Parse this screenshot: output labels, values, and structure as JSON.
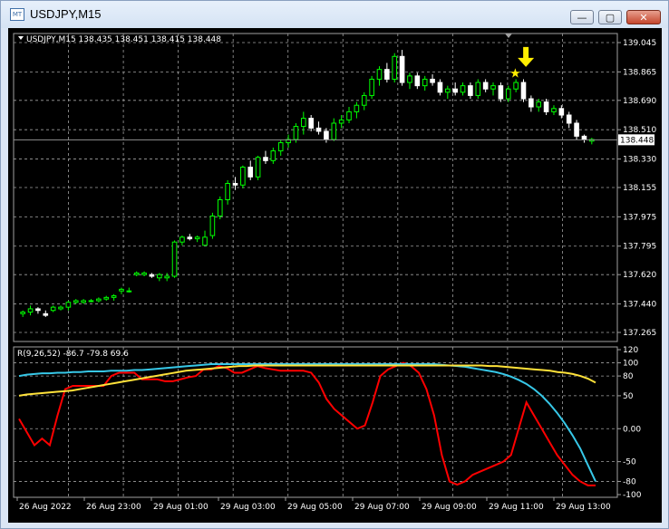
{
  "window": {
    "title": "USDJPY,M15",
    "app_icon_label": "MT",
    "buttons": {
      "minimize": "—",
      "maximize": "▢",
      "close": "✕"
    }
  },
  "colors": {
    "background": "#000000",
    "grid": "#a0a0a0",
    "bull_candle": "#00ff00",
    "bear_candle": "#ffffff",
    "red_line": "#ff0000",
    "cyan_line": "#37c8e8",
    "yellow_line": "#ffe23a",
    "arrow": "#ffee00",
    "text": "#ffffff"
  },
  "chart_header": {
    "symbol_line": "USDJPY,M15  138.435 138.451 138.415 138.448"
  },
  "current_price_label": "138.448",
  "indicator_label": "R(9,26,52) -86.7 -79.8 69.6",
  "price_axis_labels": [
    "139.045",
    "138.865",
    "138.690",
    "138.510",
    "138.330",
    "138.155",
    "137.975",
    "137.795",
    "137.620",
    "137.440",
    "137.265"
  ],
  "indicator_axis_labels": [
    "120",
    "100",
    "80",
    "50",
    "0.00",
    "-50",
    "-80",
    "-100"
  ],
  "time_labels": [
    "26 Aug 2022",
    "26 Aug 23:00",
    "29 Aug 01:00",
    "29 Aug 03:00",
    "29 Aug 05:00",
    "29 Aug 07:00",
    "29 Aug 09:00",
    "29 Aug 11:00",
    "29 Aug 13:00"
  ],
  "chart_data": {
    "type": "line",
    "price_range": [
      137.265,
      139.045
    ],
    "indicator_range": [
      -100,
      120
    ],
    "candles": [
      [
        137.38,
        137.4,
        137.36,
        137.39
      ],
      [
        137.39,
        137.43,
        137.37,
        137.41
      ],
      [
        137.41,
        137.42,
        137.38,
        137.4
      ],
      [
        137.38,
        137.4,
        137.36,
        137.37
      ],
      [
        137.4,
        137.43,
        137.39,
        137.42
      ],
      [
        137.41,
        137.43,
        137.4,
        137.42
      ],
      [
        137.42,
        137.46,
        137.4,
        137.45
      ],
      [
        137.45,
        137.47,
        137.44,
        137.46
      ],
      [
        137.45,
        137.47,
        137.44,
        137.46
      ],
      [
        137.46,
        137.47,
        137.45,
        137.46
      ],
      [
        137.46,
        137.48,
        137.45,
        137.47
      ],
      [
        137.47,
        137.49,
        137.46,
        137.48
      ],
      [
        137.48,
        137.5,
        137.46,
        137.49
      ],
      [
        137.52,
        137.54,
        137.5,
        137.53
      ],
      [
        137.52,
        137.54,
        137.51,
        137.52
      ],
      [
        137.62,
        137.64,
        137.61,
        137.63
      ],
      [
        137.62,
        137.64,
        137.61,
        137.63
      ],
      [
        137.62,
        137.63,
        137.6,
        137.61
      ],
      [
        137.6,
        137.63,
        137.58,
        137.62
      ],
      [
        137.6,
        137.63,
        137.58,
        137.61
      ],
      [
        137.61,
        137.83,
        137.6,
        137.82
      ],
      [
        137.82,
        137.86,
        137.8,
        137.85
      ],
      [
        137.85,
        137.87,
        137.83,
        137.84
      ],
      [
        137.84,
        137.86,
        137.82,
        137.85
      ],
      [
        137.8,
        137.89,
        137.8,
        137.85
      ],
      [
        137.86,
        138.0,
        137.84,
        137.98
      ],
      [
        137.98,
        138.1,
        137.96,
        138.08
      ],
      [
        138.08,
        138.2,
        138.05,
        138.18
      ],
      [
        138.18,
        138.22,
        138.14,
        138.17
      ],
      [
        138.17,
        138.29,
        138.15,
        138.28
      ],
      [
        138.28,
        138.32,
        138.2,
        138.22
      ],
      [
        138.22,
        138.35,
        138.2,
        138.34
      ],
      [
        138.34,
        138.38,
        138.3,
        138.32
      ],
      [
        138.32,
        138.4,
        138.3,
        138.38
      ],
      [
        138.38,
        138.45,
        138.35,
        138.43
      ],
      [
        138.43,
        138.48,
        138.4,
        138.45
      ],
      [
        138.45,
        138.55,
        138.43,
        138.53
      ],
      [
        138.53,
        138.62,
        138.48,
        138.58
      ],
      [
        138.58,
        138.6,
        138.5,
        138.52
      ],
      [
        138.52,
        138.56,
        138.48,
        138.5
      ],
      [
        138.5,
        138.52,
        138.43,
        138.45
      ],
      [
        138.45,
        138.58,
        138.44,
        138.55
      ],
      [
        138.55,
        138.6,
        138.52,
        138.57
      ],
      [
        138.57,
        138.65,
        138.55,
        138.62
      ],
      [
        138.62,
        138.68,
        138.58,
        138.66
      ],
      [
        138.66,
        138.74,
        138.63,
        138.72
      ],
      [
        138.72,
        138.84,
        138.7,
        138.82
      ],
      [
        138.82,
        138.9,
        138.78,
        138.88
      ],
      [
        138.88,
        138.92,
        138.8,
        138.82
      ],
      [
        138.82,
        138.98,
        138.8,
        138.96
      ],
      [
        138.96,
        139.0,
        138.78,
        138.8
      ],
      [
        138.8,
        138.86,
        138.76,
        138.84
      ],
      [
        138.84,
        138.86,
        138.76,
        138.78
      ],
      [
        138.78,
        138.84,
        138.75,
        138.82
      ],
      [
        138.82,
        138.85,
        138.78,
        138.8
      ],
      [
        138.8,
        138.82,
        138.72,
        138.74
      ],
      [
        138.74,
        138.78,
        138.7,
        138.76
      ],
      [
        138.76,
        138.8,
        138.72,
        138.74
      ],
      [
        138.74,
        138.8,
        138.72,
        138.78
      ],
      [
        138.78,
        138.8,
        138.7,
        138.72
      ],
      [
        138.72,
        138.82,
        138.7,
        138.8
      ],
      [
        138.8,
        138.82,
        138.74,
        138.76
      ],
      [
        138.76,
        138.8,
        138.72,
        138.78
      ],
      [
        138.78,
        138.8,
        138.68,
        138.7
      ],
      [
        138.7,
        138.78,
        138.68,
        138.76
      ],
      [
        138.76,
        138.82,
        138.74,
        138.8
      ],
      [
        138.8,
        138.82,
        138.68,
        138.7
      ],
      [
        138.7,
        138.72,
        138.62,
        138.65
      ],
      [
        138.65,
        138.7,
        138.62,
        138.68
      ],
      [
        138.68,
        138.7,
        138.6,
        138.62
      ],
      [
        138.62,
        138.66,
        138.6,
        138.64
      ],
      [
        138.64,
        138.66,
        138.58,
        138.6
      ],
      [
        138.6,
        138.62,
        138.52,
        138.55
      ],
      [
        138.55,
        138.57,
        138.45,
        138.47
      ],
      [
        138.47,
        138.48,
        138.43,
        138.45
      ],
      [
        138.44,
        138.46,
        138.42,
        138.45
      ]
    ],
    "signal": {
      "arrow_price": 138.94,
      "star_price": 138.86,
      "candle_index": 65
    },
    "series": [
      {
        "color": "red",
        "values": [
          15,
          -5,
          -25,
          -15,
          -25,
          20,
          60,
          65,
          65,
          65,
          65,
          65,
          80,
          85,
          85,
          85,
          75,
          75,
          75,
          72,
          72,
          75,
          78,
          80,
          90,
          90,
          95,
          92,
          85,
          85,
          90,
          95,
          92,
          90,
          88,
          88,
          88,
          88,
          85,
          70,
          45,
          30,
          20,
          10,
          0,
          5,
          40,
          80,
          90,
          95,
          100,
          95,
          85,
          60,
          20,
          -40,
          -80,
          -85,
          -80,
          -70,
          -65,
          -60,
          -55,
          -50,
          -40,
          0,
          40,
          20,
          0,
          -20,
          -40,
          -55,
          -70,
          -80,
          -86,
          -86
        ]
      },
      {
        "color": "cyan",
        "values": [
          80,
          82,
          83,
          84,
          84,
          85,
          85,
          86,
          86,
          87,
          87,
          87,
          88,
          88,
          88,
          89,
          89,
          90,
          91,
          92,
          93,
          94,
          95,
          96,
          97,
          98,
          98,
          98,
          98,
          98,
          98,
          98,
          98,
          98,
          98,
          98,
          98,
          98,
          98,
          98,
          98,
          98,
          98,
          98,
          98,
          98,
          98,
          98,
          98,
          98,
          98,
          98,
          98,
          98,
          98,
          97,
          96,
          95,
          94,
          92,
          90,
          88,
          86,
          83,
          79,
          74,
          68,
          60,
          50,
          38,
          24,
          8,
          -10,
          -30,
          -55,
          -80
        ]
      },
      {
        "color": "yellow",
        "values": [
          50,
          52,
          53,
          54,
          55,
          56,
          57,
          58,
          60,
          62,
          64,
          66,
          68,
          70,
          72,
          74,
          76,
          78,
          80,
          82,
          84,
          86,
          88,
          89,
          90,
          91,
          92,
          93,
          94,
          95,
          95,
          96,
          96,
          96,
          96,
          96,
          96,
          96,
          96,
          96,
          96,
          96,
          96,
          96,
          96,
          96,
          96,
          96,
          96,
          96,
          96,
          96,
          96,
          96,
          96,
          96,
          96,
          96,
          96,
          96,
          96,
          96,
          95,
          95,
          94,
          93,
          92,
          91,
          90,
          89,
          88,
          86,
          85,
          83,
          80,
          76,
          70
        ]
      }
    ]
  }
}
